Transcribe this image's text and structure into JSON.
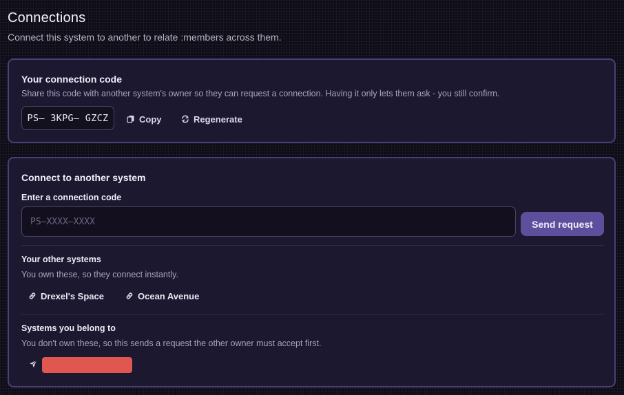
{
  "page": {
    "title": "Connections",
    "subtitle": "Connect this system to another to relate :members across them."
  },
  "connection_code_card": {
    "title": "Your connection code",
    "description": "Share this code with another system's owner so they can request a connection. Having it only lets them ask - you still confirm.",
    "code": "PS– 3KPG– GZCZ",
    "copy_label": "Copy",
    "copy_icon": "copy-icon",
    "regenerate_label": "Regenerate",
    "regenerate_icon": "refresh-icon"
  },
  "connect_card": {
    "title": "Connect to another system",
    "input_label": "Enter a connection code",
    "input_placeholder": "PS–XXXX–XXXX",
    "input_value": "",
    "send_label": "Send request",
    "own_systems": {
      "heading": "Your other systems",
      "description": "You own these, so they connect instantly.",
      "items": [
        {
          "label": "Drexel's Space",
          "icon": "link-icon"
        },
        {
          "label": "Ocean Avenue",
          "icon": "link-icon"
        }
      ]
    },
    "member_systems": {
      "heading": "Systems you belong to",
      "description": "You don't own these, so this sends a request the other owner must accept first.",
      "items": [
        {
          "icon": "send-icon",
          "redacted": true
        }
      ]
    }
  },
  "colors": {
    "background": "#0e0c17",
    "card": "#1c1830",
    "card_border": "#4a3f78",
    "accent_button": "#5e4f9c",
    "redaction": "#e0574f"
  }
}
